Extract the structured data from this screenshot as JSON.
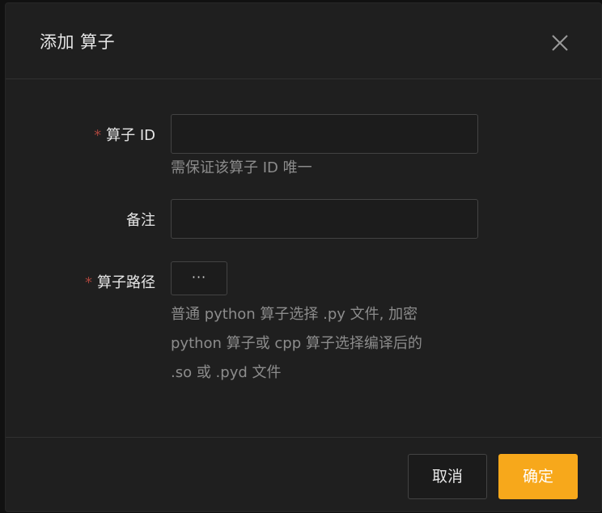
{
  "dialog": {
    "title": "添加 算子",
    "close_icon": "close-icon"
  },
  "form": {
    "operator_id": {
      "required_mark": "*",
      "label": "算子 ID",
      "value": "",
      "placeholder": "",
      "hint": "需保证该算子 ID 唯一"
    },
    "remark": {
      "label": "备注",
      "value": "",
      "placeholder": ""
    },
    "operator_path": {
      "required_mark": "*",
      "label": "算子路径",
      "button_label": "···",
      "hint_lines": [
        "普通 python 算子选择 .py 文件, 加密",
        "python 算子或 cpp 算子选择编译后的",
        ".so 或 .pyd 文件"
      ]
    }
  },
  "footer": {
    "cancel_label": "取消",
    "ok_label": "确定"
  },
  "colors": {
    "accent": "#f7a81b",
    "required": "#a8443c",
    "dialog_bg": "#1f1f1f"
  }
}
